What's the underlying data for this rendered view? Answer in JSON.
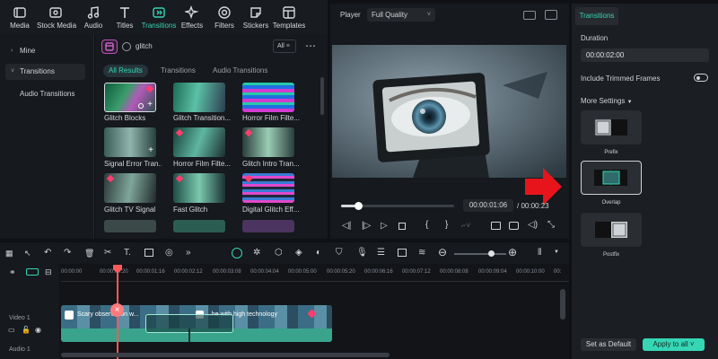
{
  "toolbar": {
    "items": [
      {
        "label": "Media",
        "icon": "media-icon"
      },
      {
        "label": "Stock Media",
        "icon": "stock-media-icon"
      },
      {
        "label": "Audio",
        "icon": "music-note-icon"
      },
      {
        "label": "Titles",
        "icon": "text-icon"
      },
      {
        "label": "Transitions",
        "icon": "transitions-icon"
      },
      {
        "label": "Effects",
        "icon": "sparkle-icon"
      },
      {
        "label": "Filters",
        "icon": "filter-icon"
      },
      {
        "label": "Stickers",
        "icon": "sticker-icon"
      },
      {
        "label": "Templates",
        "icon": "template-icon"
      }
    ]
  },
  "leftnav": {
    "items": [
      "Mine",
      "Transitions",
      "Audio Transitions"
    ]
  },
  "library": {
    "search_value": "glitch",
    "filter_label": "All",
    "tabs": [
      "All Results",
      "Transitions",
      "Audio Transitions"
    ],
    "thumbs": [
      "Glitch Blocks",
      "Glitch Transition...",
      "Horror Film Filte...",
      "Signal Error Tran...",
      "Horror Film Filte...",
      "Glitch Intro Tran...",
      "Glitch TV Signal",
      "Fast Glitch",
      "Digital Glitch Eff..."
    ]
  },
  "player": {
    "label": "Player",
    "quality": "Full Quality",
    "current_time": "00:00:01:06",
    "total_time": "00:00:",
    "total_time_tail": "23",
    "progress": 0.15
  },
  "rpanel": {
    "tab": "Transitions",
    "duration_label": "Duration",
    "duration_value": "00:00:02:00",
    "trimmed_label": "Include Trimmed Frames",
    "more_label": "More Settings",
    "align_options": [
      "Prefix",
      "Overlap",
      "Postfix"
    ],
    "default_btn": "Set as Default",
    "apply_btn": "Apply to all"
  },
  "timeline": {
    "ticks": [
      "00:00:00",
      "00:00:00:20",
      "00:00:01:16",
      "00:00:02:12",
      "00:00:03:08",
      "00:00:04:04",
      "00:00:05:00",
      "00:00:05:20",
      "00:00:06:16",
      "00:00:07:12",
      "00:00:08:08",
      "00:00:09:04",
      "00:00:10:00",
      "00:"
    ],
    "track_label": "Video 1",
    "track2_label": "Audio 1",
    "clip1_text": "Scary observation w...",
    "clip2_text": "...he with high technology",
    "zoom_level": 0.7
  },
  "colors": {
    "accent": "#36d6b5",
    "arrow": "#e8141b",
    "playhead": "#ff5a5a"
  }
}
